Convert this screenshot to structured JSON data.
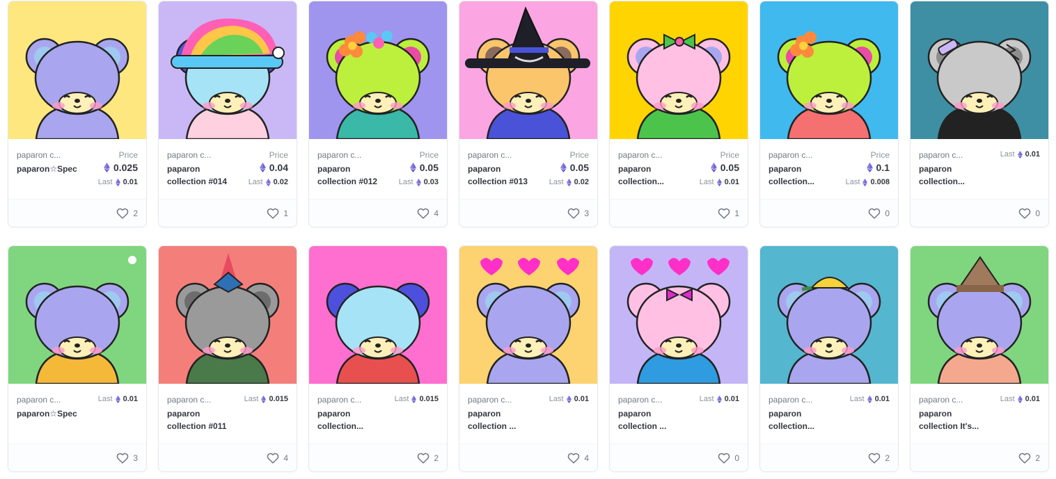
{
  "cards": [
    {
      "collection": "paparon c...",
      "name": [
        "paparon☆Spec"
      ],
      "price_label": "Price",
      "price": "0.025",
      "last_label": "Last",
      "last": "0.01",
      "favorites": "2",
      "bg": "#fde77e",
      "body": "#a9a6ef",
      "ears": "#a9a6ef",
      "ear_inner": "#9fc9f0",
      "shirt": "#a9a6ef",
      "hat": "",
      "art": "dj-bear"
    },
    {
      "collection": "paparon c...",
      "name": [
        "paparon",
        "collection #014"
      ],
      "price_label": "Price",
      "price": "0.04",
      "last_label": "Last",
      "last": "0.02",
      "favorites": "1",
      "bg": "#c9b8f5",
      "body": "#a7e3f7",
      "ears": "#5056e0",
      "ear_inner": "#5056e0",
      "shirt": "#ffd0e0",
      "hat": "rainbow",
      "art": "dog-nightcap"
    },
    {
      "collection": "paparon c...",
      "name": [
        "paparon",
        "collection #012"
      ],
      "price_label": "Price",
      "price": "0.05",
      "last_label": "Last",
      "last": "0.03",
      "favorites": "4",
      "bg": "#9f94ee",
      "body": "#bdf03c",
      "ears": "#bdf03c",
      "ear_inner": "#e94ba5",
      "shirt": "#3ab8a8",
      "hat": "flowers",
      "art": "bunny-flowers"
    },
    {
      "collection": "paparon c...",
      "name": [
        "paparon",
        "collection #013"
      ],
      "price_label": "Price",
      "price": "0.05",
      "last_label": "Last",
      "last": "0.02",
      "favorites": "3",
      "bg": "#fba5e2",
      "body": "#fbc56c",
      "ears": "#fbc56c",
      "ear_inner": "#8b6b5c",
      "shirt": "#4a53d8",
      "hat": "witch",
      "art": "cat-witch"
    },
    {
      "collection": "paparon c...",
      "name": [
        "paparon",
        "collection..."
      ],
      "price_label": "Price",
      "price": "0.05",
      "last_label": "Last",
      "last": "0.01",
      "favorites": "1",
      "bg": "#ffd400",
      "body": "#ffc0e4",
      "ears": "#ffc0e4",
      "ear_inner": "#a9a6ef",
      "shirt": "#4cc44c",
      "hat": "bow",
      "art": "pink-bear-bow"
    },
    {
      "collection": "paparon c...",
      "name": [
        "paparon",
        "collection..."
      ],
      "price_label": "Price",
      "price": "0.1",
      "last_label": "Last",
      "last": "0.008",
      "favorites": "0",
      "bg": "#40b9ef",
      "body": "#bdf03c",
      "ears": "#bdf03c",
      "ear_inner": "#e94ba5",
      "shirt": "#f57070",
      "hat": "flower",
      "art": "bunny-flower"
    },
    {
      "collection": "paparon c...",
      "name": [
        "paparon",
        "collection..."
      ],
      "price_label": "",
      "price": "",
      "last_label": "Last",
      "last": "0.01",
      "favorites": "0",
      "bg": "#3e8fa3",
      "body": "#c9c9c9",
      "ears": "#c9c9c9",
      "ear_inner": "#8d8d8d",
      "shirt": "#222222",
      "hat": "bandage",
      "art": "zombie-bear"
    },
    {
      "collection": "paparon c...",
      "name": [
        "paparon☆Spec"
      ],
      "price_label": "",
      "price": "",
      "last_label": "Last",
      "last": "0.01",
      "favorites": "3",
      "bg": "#7fd67f",
      "body": "#a9a6ef",
      "ears": "#a9a6ef",
      "ear_inner": "#9fc9f0",
      "shirt": "#f5b93a",
      "hat": "note",
      "art": "bear-wall"
    },
    {
      "collection": "paparon c...",
      "name": [
        "paparon",
        "collection #011"
      ],
      "price_label": "",
      "price": "",
      "last_label": "Last",
      "last": "0.015",
      "favorites": "4",
      "bg": "#f47f7a",
      "body": "#9a9a9a",
      "ears": "#9a9a9a",
      "ear_inner": "#6d6d6d",
      "shirt": "#4a7a4a",
      "hat": "mohawk",
      "art": "zombie-warrior"
    },
    {
      "collection": "paparon c...",
      "name": [
        "paparon",
        "collection..."
      ],
      "price_label": "",
      "price": "",
      "last_label": "Last",
      "last": "0.015",
      "favorites": "2",
      "bg": "#ff6fd0",
      "body": "#a7e3f7",
      "ears": "#4c50dc",
      "ear_inner": "#4c50dc",
      "shirt": "#e85050",
      "hat": "",
      "art": "dog-stripes"
    },
    {
      "collection": "paparon c...",
      "name": [
        "paparon",
        "collection    ..."
      ],
      "price_label": "",
      "price": "",
      "last_label": "Last",
      "last": "0.01",
      "favorites": "4",
      "bg": "#fdd270",
      "body": "#a9a6ef",
      "ears": "#a9a6ef",
      "ear_inner": "#9fc9f0",
      "shirt": "#a9a6ef",
      "hat": "hearts",
      "art": "bear-hearts"
    },
    {
      "collection": "paparon c...",
      "name": [
        "paparon",
        "collection    ..."
      ],
      "price_label": "",
      "price": "",
      "last_label": "Last",
      "last": "0.01",
      "favorites": "0",
      "bg": "#c4b5f7",
      "body": "#ffc0e4",
      "ears": "#ffc0e4",
      "ear_inner": "#ffc0e4",
      "shirt": "#2f9be0",
      "hat": "hearts-bow",
      "art": "pink-bear-hearts"
    },
    {
      "collection": "paparon c...",
      "name": [
        "paparon",
        "collection..."
      ],
      "price_label": "",
      "price": "",
      "last_label": "Last",
      "last": "0.01",
      "favorites": "2",
      "bg": "#54b6cf",
      "body": "#a9a6ef",
      "ears": "#a9a6ef",
      "ear_inner": "#9fc9f0",
      "shirt": "#a9a6ef",
      "hat": "cap",
      "art": "bear-baseball"
    },
    {
      "collection": "paparon c...",
      "name": [
        "paparon",
        "collection It's..."
      ],
      "price_label": "",
      "price": "",
      "last_label": "Last",
      "last": "0.01",
      "favorites": "2",
      "bg": "#7fd67f",
      "body": "#a9a6ef",
      "ears": "#a9a6ef",
      "ear_inner": "#9fc9f0",
      "shirt": "#f4a98e",
      "hat": "beanie",
      "art": "bear-sweater"
    }
  ]
}
